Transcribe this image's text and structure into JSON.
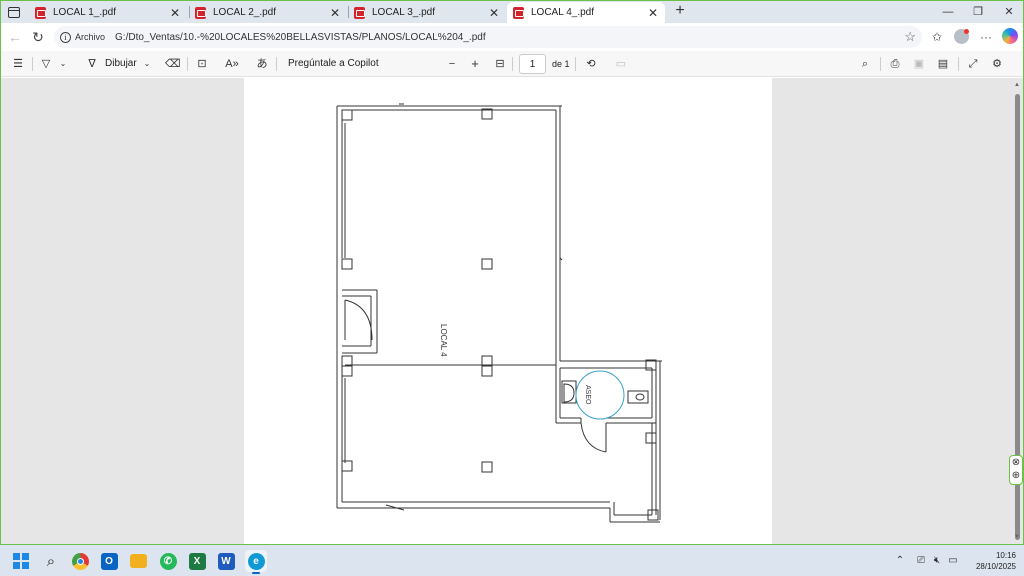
{
  "browser": {
    "tabs": [
      {
        "title": "LOCAL 1_.pdf",
        "active": false
      },
      {
        "title": "LOCAL 2_.pdf",
        "active": false
      },
      {
        "title": "LOCAL 3_.pdf",
        "active": false
      },
      {
        "title": "LOCAL 4_.pdf",
        "active": true
      }
    ],
    "new_tab_icon": "plus-icon",
    "address": {
      "label": "Archivo",
      "url": "G:/Dto_Ventas/10.-%20LOCALES%20BELLASVISTAS/PLANOS/LOCAL%204_.pdf"
    }
  },
  "pdf_toolbar": {
    "draw_label": "Dibujar",
    "copilot_label": "Pregúntale a Copilot",
    "page_current": "1",
    "page_total": "de 1"
  },
  "document": {
    "room_main": "LOCAL 4",
    "room_wc": "ASEO"
  },
  "taskbar": {
    "time": "10:16",
    "date": "28/10/2025"
  },
  "colors": {
    "window_border": "#6cc04a",
    "tab_strip": "#dfe6ee",
    "viewer_bg": "#e6e6e6",
    "taskbar": "#dce5ef",
    "highlight_circle": "#3aa0c8"
  }
}
